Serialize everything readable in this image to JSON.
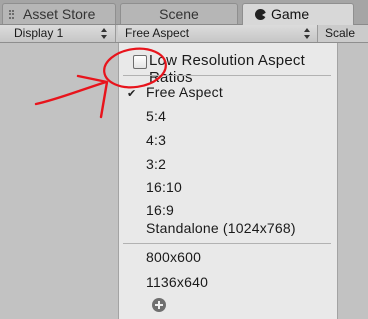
{
  "tabs": [
    {
      "label": "Asset Store"
    },
    {
      "label": "Scene"
    },
    {
      "label": "Game"
    }
  ],
  "toolbar": {
    "display_label": "Display 1",
    "aspect_label": "Free Aspect",
    "scale_label": "Scale"
  },
  "menu": {
    "low_res_label": "Low Resolution Aspect Ratios",
    "low_res_checked": false,
    "selected": "Free Aspect",
    "items": [
      {
        "label": "Free Aspect"
      },
      {
        "label": "5:4"
      },
      {
        "label": "4:3"
      },
      {
        "label": "3:2"
      },
      {
        "label": "16:10"
      },
      {
        "label": "16:9"
      },
      {
        "label": "Standalone (1024x768)"
      }
    ],
    "custom_items": [
      {
        "label": "800x600"
      },
      {
        "label": "1136x640"
      }
    ]
  },
  "icons": {
    "selected_check": "checkmark-icon",
    "add": "plus-circle-icon",
    "game_tab": "pacman-icon"
  },
  "colors": {
    "annotation": "#e8141c"
  }
}
